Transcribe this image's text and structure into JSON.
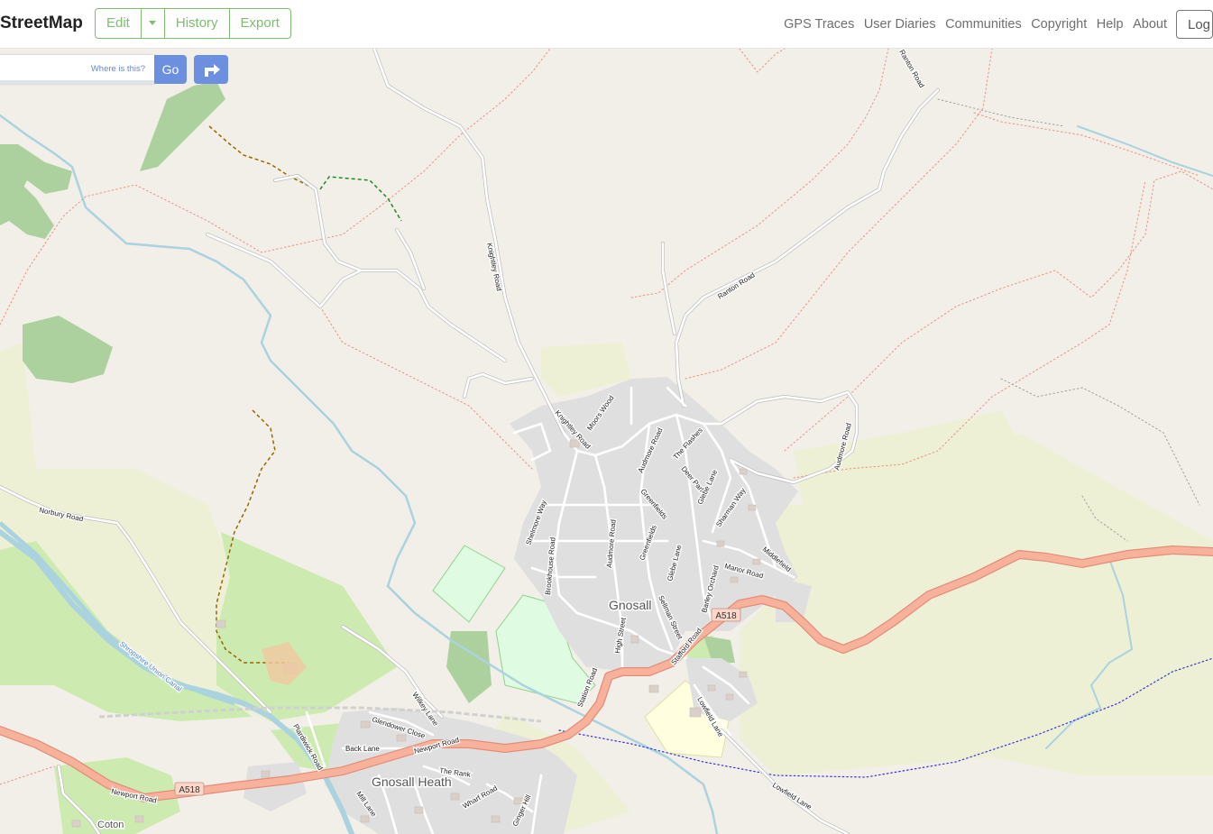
{
  "header": {
    "brand": "StreetMap",
    "edit_label": "Edit",
    "history_label": "History",
    "export_label": "Export",
    "nav": [
      "GPS Traces",
      "User Diaries",
      "Communities",
      "Copyright",
      "Help",
      "About"
    ],
    "login_label": "Log"
  },
  "search": {
    "where_label": "Where is this?",
    "go_label": "Go"
  },
  "map": {
    "places": {
      "gnosall": "Gnosall",
      "gnosall_heath": "Gnosall Heath",
      "coton": "Coton"
    },
    "route_ref_1": "A518",
    "route_ref_2": "A518",
    "roads": {
      "ranton_road_top": "Ranton Road",
      "ranton_road": "Ranton Road",
      "knightley_road_north": "Knightley Road",
      "knightley_road": "Knightley Road",
      "moors_wood": "Moors Wood",
      "audmore_road": "Audmore Road",
      "audmore_road_east": "Audmore Road",
      "audmore_road_south": "Audmore Road",
      "the_flashes": "The Flashes",
      "deer_park": "Deer Park",
      "glebe_lane": "Glebe Lane",
      "glebe_lane_2": "Glebe Lane",
      "greenfields": "Greenfields",
      "greenfields_2": "Greenfields",
      "shelmore_way": "Shelmore Way",
      "sharman_way": "Sharman Way",
      "middlefield": "Middlefield",
      "manor_road": "Manor Road",
      "barley_orchard": "Barley Orchard",
      "sellman_street": "Sellman Street",
      "brookhouse_road": "Brookhouse Road",
      "high_street": "High Street",
      "station_road": "Station Road",
      "stafford_road": "Stafford Road",
      "lowfield_lane": "Lowfield Lane",
      "lowfield_lane_2": "Lowfield Lane",
      "norbury_road": "Norbury Road",
      "newport_road": "Newport Road",
      "newport_road_2": "Newport Road",
      "plardiwick_road": "Plardiwick Road",
      "wilkey_lane": "Wilkey Lane",
      "glendower_close": "Glendower Close",
      "back_lane": "Back Lane",
      "the_rank": "The Rank",
      "wharf_road": "Wharf Road",
      "mill_lane": "Mill Lane",
      "ginger_hill": "Ginger Hill",
      "shropshire_union_canal": "Shropshire Union Canal"
    },
    "colors": {
      "land": "#f2efe9",
      "farmland": "#eef0d5",
      "wood": "#add19e",
      "grass": "#cdebb0",
      "residential": "#e0dfdf",
      "primary_road": "#f8b29c",
      "primary_road_casing": "#e38d78",
      "water": "#aad3df",
      "canal": "#aad3df"
    }
  }
}
